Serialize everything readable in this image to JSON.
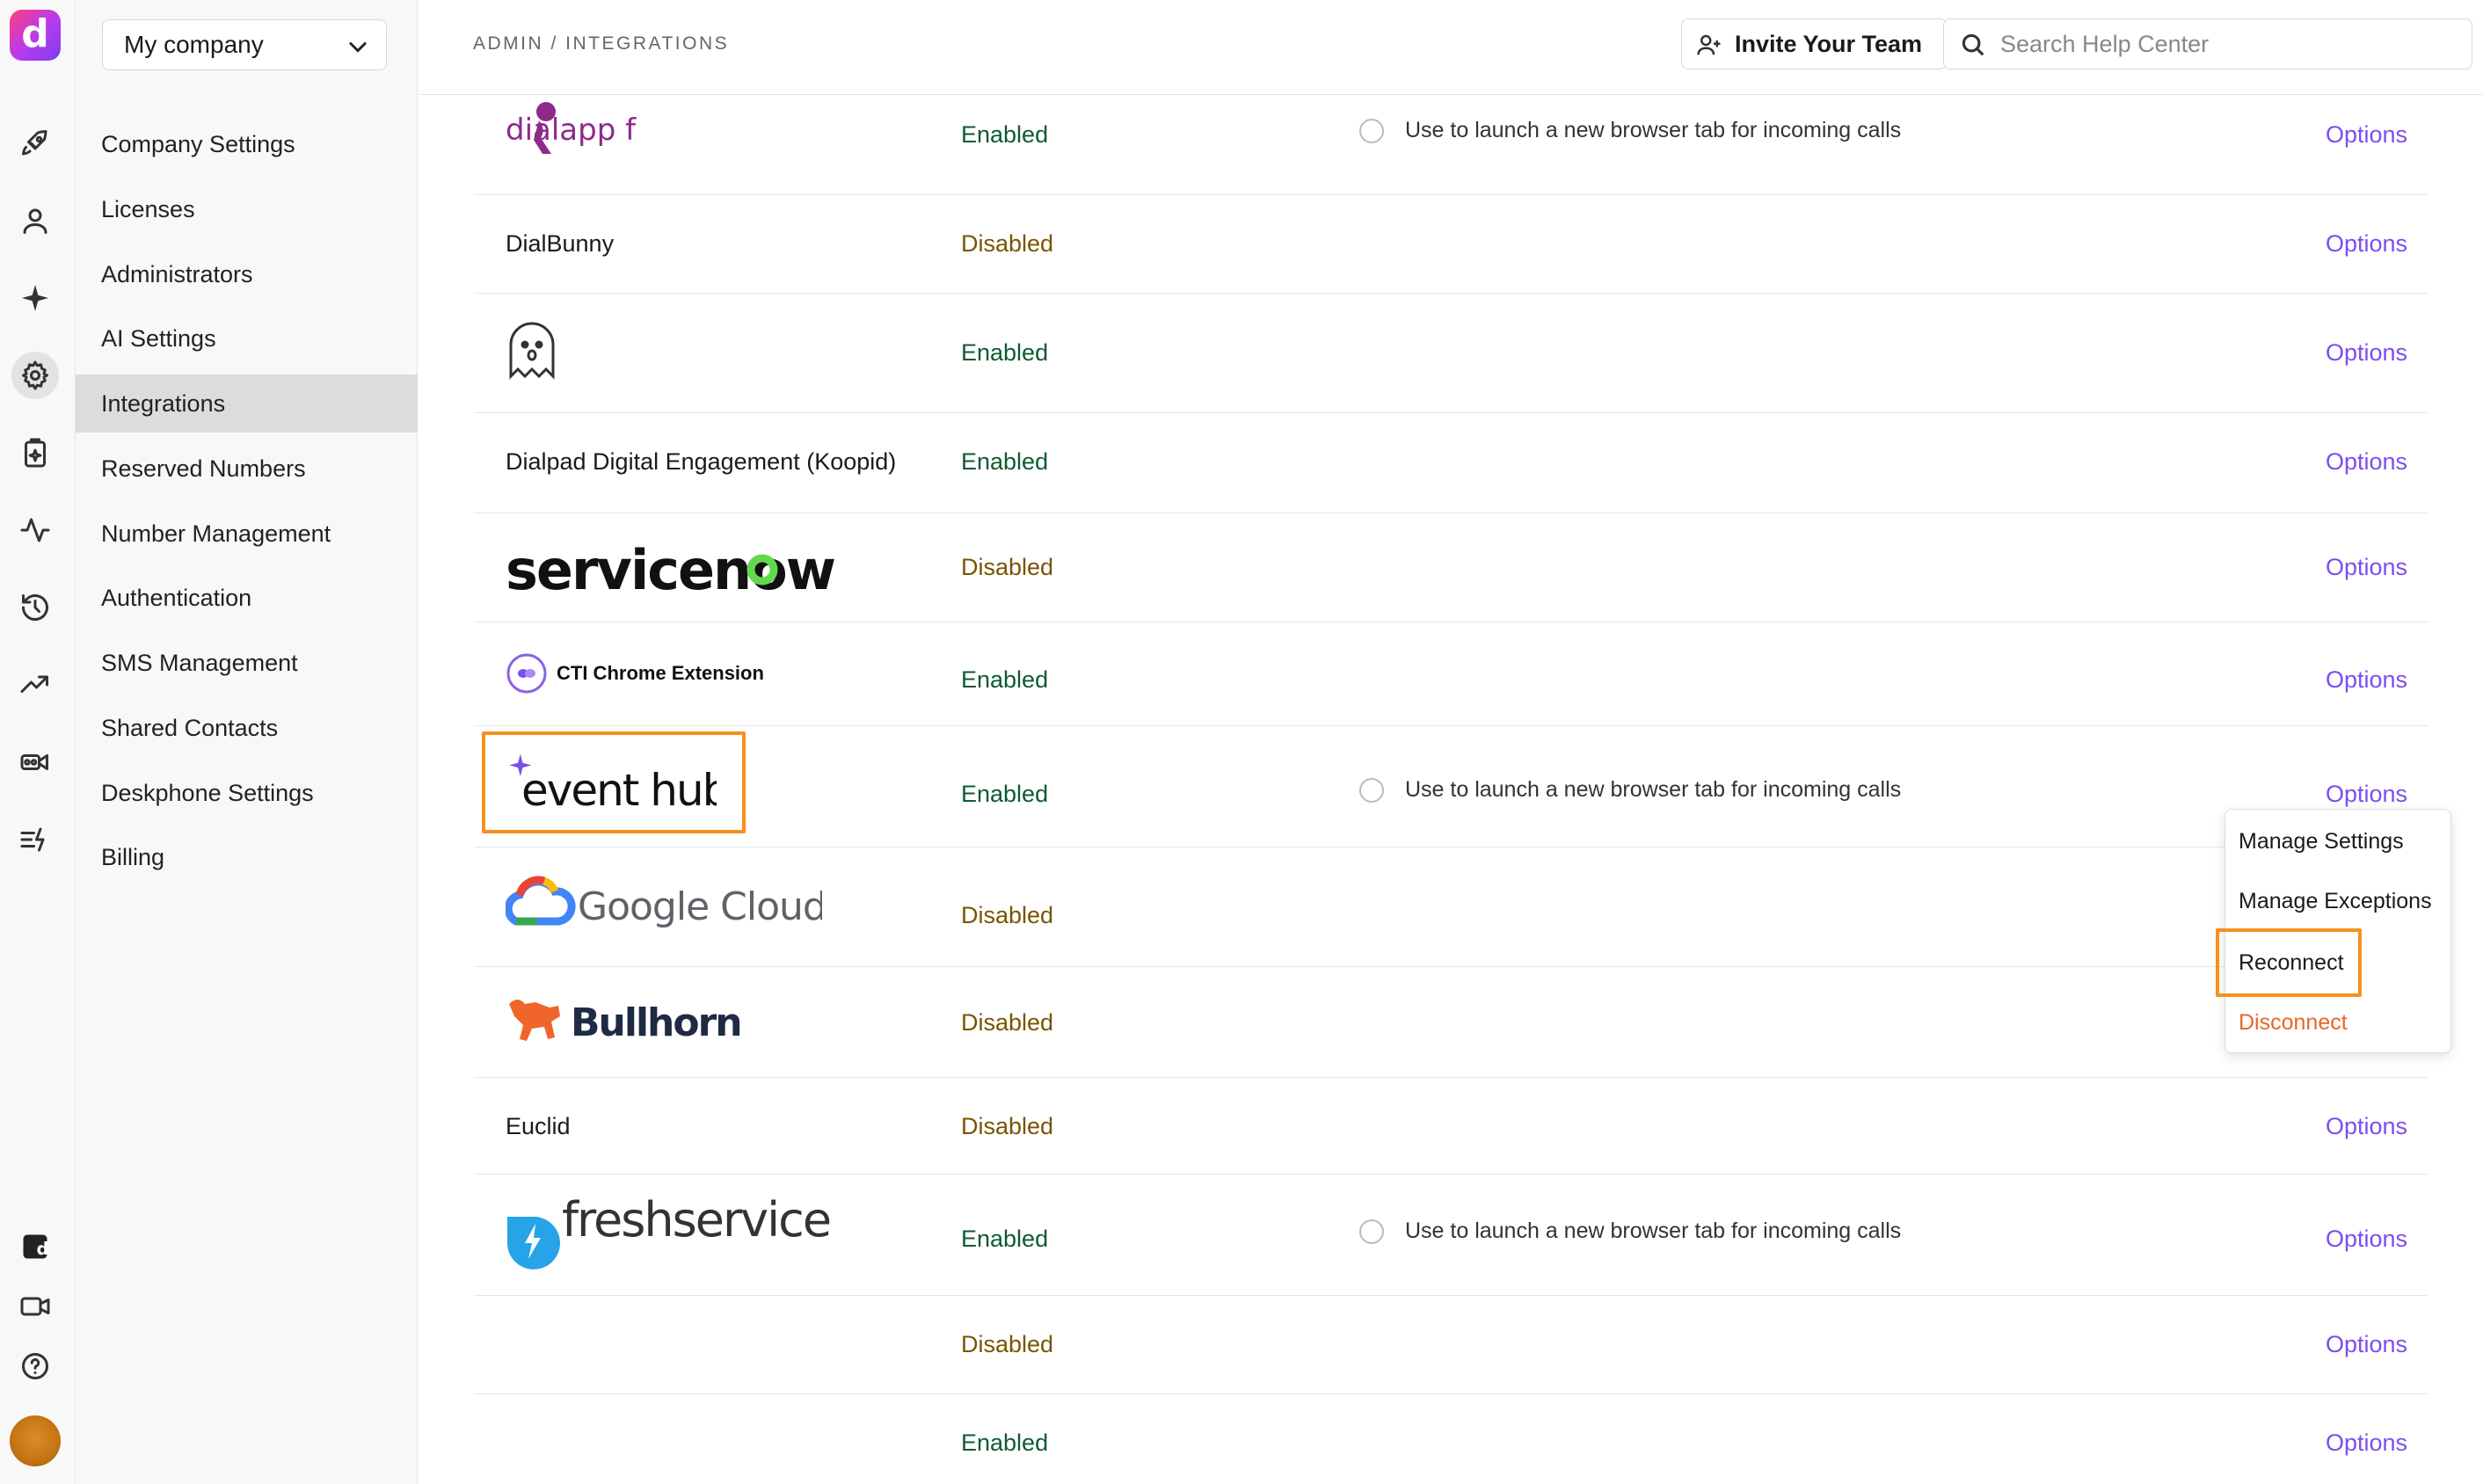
{
  "rail": {
    "logo_letter": "d",
    "items": [
      "rocket-icon",
      "person-icon",
      "sparkle-icon",
      "gear-icon",
      "clipboard-sparkle-icon",
      "activity-icon",
      "history-icon",
      "trending-icon",
      "video-camera-icon",
      "list-bolt-icon"
    ],
    "bottom": [
      "dialpad-app-icon",
      "video-icon",
      "help-icon",
      "avatar"
    ]
  },
  "nav": {
    "company": "My company",
    "items": [
      "Company Settings",
      "Licenses",
      "Administrators",
      "AI Settings",
      "Integrations",
      "Reserved Numbers",
      "Number Management",
      "Authentication",
      "SMS Management",
      "Shared Contacts",
      "Deskphone Settings",
      "Billing"
    ],
    "active": "Integrations"
  },
  "topbar": {
    "breadcrumb": "ADMIN / INTEGRATIONS",
    "invite_label": "Invite Your Team",
    "search_placeholder": "Search Help Center"
  },
  "integrations": [
    {
      "name": "dialapp framework",
      "logo": "dialapp-logo",
      "status": "Enabled",
      "launch": "Use to launch a new browser tab for incoming calls",
      "options": "Options"
    },
    {
      "name": "DialBunny",
      "status": "Disabled",
      "options": "Options"
    },
    {
      "name": "",
      "logo": "ghost-logo",
      "status": "Enabled",
      "options": "Options"
    },
    {
      "name": "Dialpad Digital Engagement (Koopid)",
      "status": "Enabled",
      "options": "Options"
    },
    {
      "name": "servicenow",
      "logo": "servicenow-logo",
      "status": "Disabled",
      "options": "Options"
    },
    {
      "name": "CTI Chrome Extension",
      "logo": "cti-logo",
      "status": "Enabled",
      "options": "Options"
    },
    {
      "name": "event hub",
      "logo": "eventhub-logo",
      "status": "Enabled",
      "launch": "Use to launch a new browser tab for incoming calls",
      "options": "Options"
    },
    {
      "name": "Google Cloud",
      "logo": "google-cloud-logo",
      "status": "Disabled",
      "options": ""
    },
    {
      "name": "Bullhorn",
      "logo": "bullhorn-logo",
      "status": "Disabled",
      "options": ""
    },
    {
      "name": "Euclid",
      "status": "Disabled",
      "options": "Options"
    },
    {
      "name": "freshservice",
      "logo": "freshservice-logo",
      "status": "Enabled",
      "launch": "Use to launch a new browser tab for incoming calls",
      "options": "Options"
    },
    {
      "name": "",
      "status": "Disabled",
      "options": "Options"
    },
    {
      "name": "",
      "status": "Enabled",
      "options": "Options"
    }
  ],
  "menu": {
    "items": [
      "Manage Settings",
      "Manage Exceptions",
      "Reconnect",
      "Disconnect"
    ]
  },
  "colors": {
    "accent": "#7b4ef0",
    "enabled": "#0f5a32",
    "disabled": "#7a5400",
    "highlight": "#f6901e",
    "danger": "#e8662a"
  }
}
